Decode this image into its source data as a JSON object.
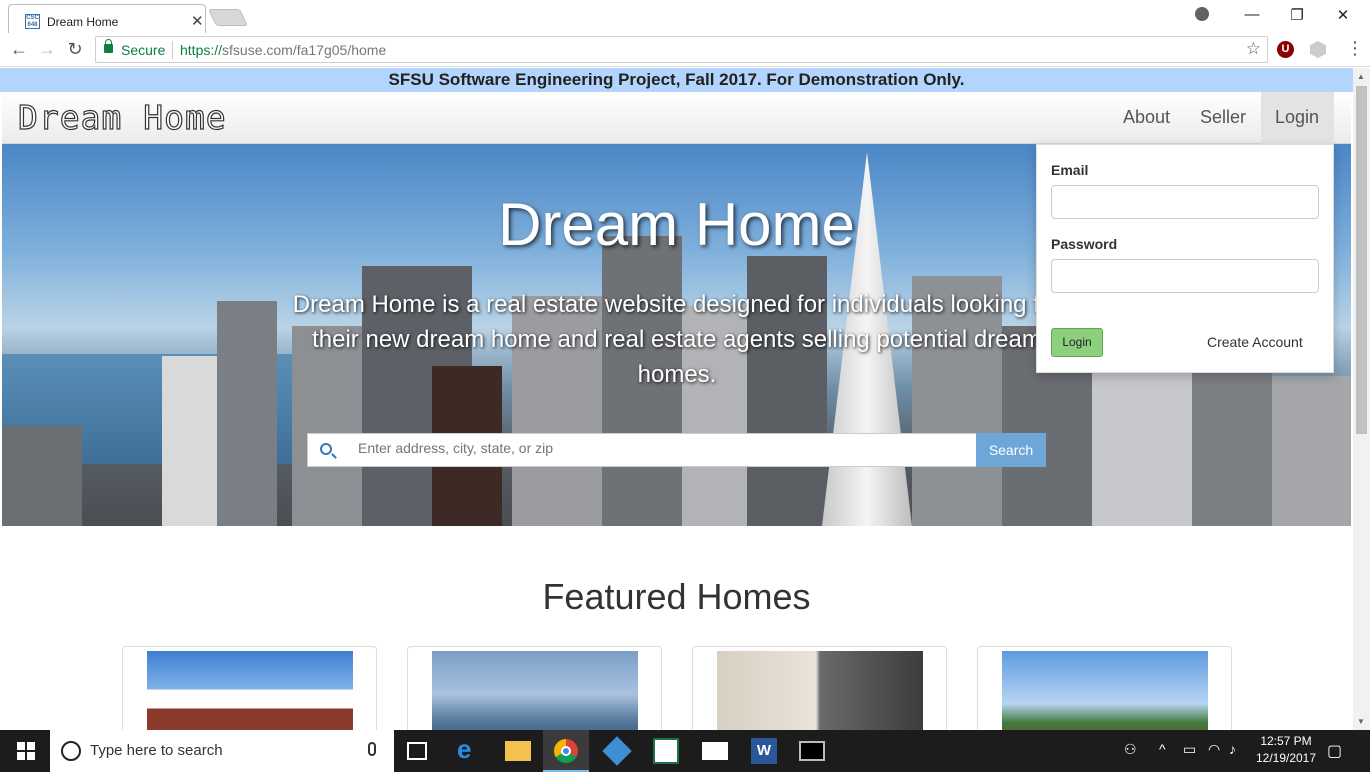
{
  "browser": {
    "tab_title": "Dream Home",
    "tab_favicon": "CSC 648",
    "secure_label": "Secure",
    "url_scheme": "https://",
    "url_rest": "sfsuse.com/fa17g05/home",
    "extension_u": "U"
  },
  "site": {
    "banner": "SFSU Software Engineering Project, Fall 2017. For Demonstration Only.",
    "brand": "Dream Home",
    "nav": {
      "about": "About",
      "seller": "Seller",
      "login": "Login"
    }
  },
  "hero": {
    "title": "Dream Home",
    "description": "Dream Home is a real estate website designed for individuals looking for their new dream home and real estate agents selling potential dream homes.",
    "search_placeholder": "Enter address, city, state, or zip",
    "search_button": "Search"
  },
  "login_dropdown": {
    "email_label": "Email",
    "password_label": "Password",
    "login_button": "Login",
    "create_account": "Create Account"
  },
  "featured": {
    "title": "Featured Homes",
    "cards": [
      {
        "image": "brick-building-with-cupola"
      },
      {
        "image": "modern-glass-building"
      },
      {
        "image": "devils-teeth-bakery"
      },
      {
        "image": "brick-building-flag"
      }
    ]
  },
  "taskbar": {
    "search_placeholder": "Type here to search",
    "time": "12:57 PM",
    "date": "12/19/2017"
  },
  "colors": {
    "banner": "#b3d4fc",
    "login_button": "#8cd07e",
    "search_button": "#6fa6d8"
  }
}
